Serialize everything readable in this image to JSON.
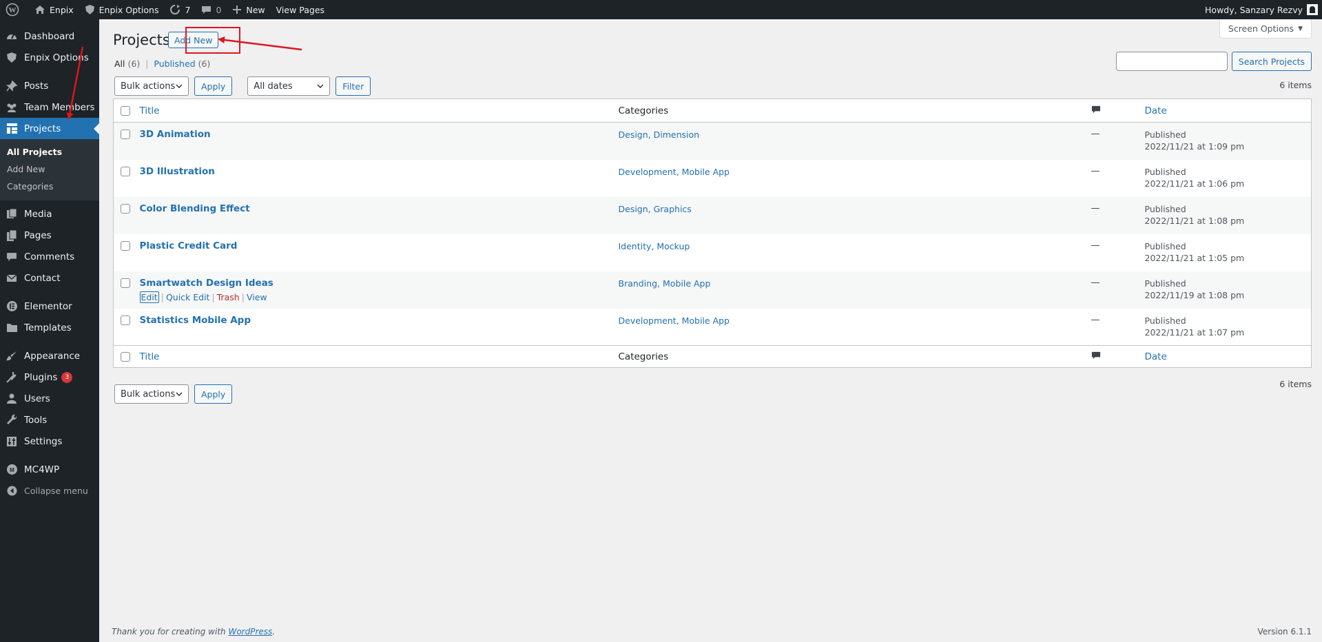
{
  "adminbar": {
    "site_name": "Enpix",
    "options_label": "Enpix Options",
    "updates_count": "7",
    "comments_count": "0",
    "new_label": "New",
    "view_pages_label": "View Pages",
    "howdy": "Howdy, Sanzary Rezvy"
  },
  "sidebar": {
    "dashboard": "Dashboard",
    "enpix_options": "Enpix Options",
    "posts": "Posts",
    "team_members": "Team Members",
    "projects": "Projects",
    "sub_all": "All Projects",
    "sub_add": "Add New",
    "sub_categories": "Categories",
    "media": "Media",
    "pages": "Pages",
    "comments": "Comments",
    "contact": "Contact",
    "elementor": "Elementor",
    "templates": "Templates",
    "appearance": "Appearance",
    "plugins": "Plugins",
    "plugins_badge": "3",
    "users": "Users",
    "tools": "Tools",
    "settings": "Settings",
    "mc4wp": "MC4WP",
    "collapse": "Collapse menu"
  },
  "page": {
    "title": "Projects",
    "add_new": "Add New",
    "screen_options": "Screen Options",
    "all_label": "All",
    "all_count": "(6)",
    "published_label": "Published",
    "published_count": "(6)",
    "search_button": "Search Projects",
    "bulk_actions": "Bulk actions",
    "apply": "Apply",
    "all_dates": "All dates",
    "filter": "Filter",
    "items": "6 items"
  },
  "table": {
    "headers": {
      "title": "Title",
      "categories": "Categories",
      "date": "Date"
    },
    "rows": [
      {
        "title": "3D Animation",
        "categories": "Design, Dimension",
        "comments": "—",
        "status": "Published",
        "date": "2022/11/21 at 1:09 pm"
      },
      {
        "title": "3D Illustration",
        "categories": "Development, Mobile App",
        "comments": "—",
        "status": "Published",
        "date": "2022/11/21 at 1:06 pm"
      },
      {
        "title": "Color Blending Effect",
        "categories": "Design, Graphics",
        "comments": "—",
        "status": "Published",
        "date": "2022/11/21 at 1:08 pm"
      },
      {
        "title": "Plastic Credit Card",
        "categories": "Identity, Mockup",
        "comments": "—",
        "status": "Published",
        "date": "2022/11/21 at 1:05 pm"
      },
      {
        "title": "Smartwatch Design Ideas",
        "categories": "Branding, Mobile App",
        "comments": "—",
        "status": "Published",
        "date": "2022/11/19 at 1:08 pm"
      },
      {
        "title": "Statistics Mobile App",
        "categories": "Development, Mobile App",
        "comments": "—",
        "status": "Published",
        "date": "2022/11/21 at 1:07 pm"
      }
    ],
    "row_actions": {
      "edit": "Edit",
      "quick_edit": "Quick Edit",
      "trash": "Trash",
      "view": "View"
    }
  },
  "footer": {
    "thanks_prefix": "Thank you for creating with",
    "wordpress": "WordPress",
    "thanks_suffix": ".",
    "version": "Version 6.1.1"
  },
  "colors": {
    "accent": "#2271b1",
    "sidebar": "#1d2327",
    "annotation": "#e0141e"
  }
}
